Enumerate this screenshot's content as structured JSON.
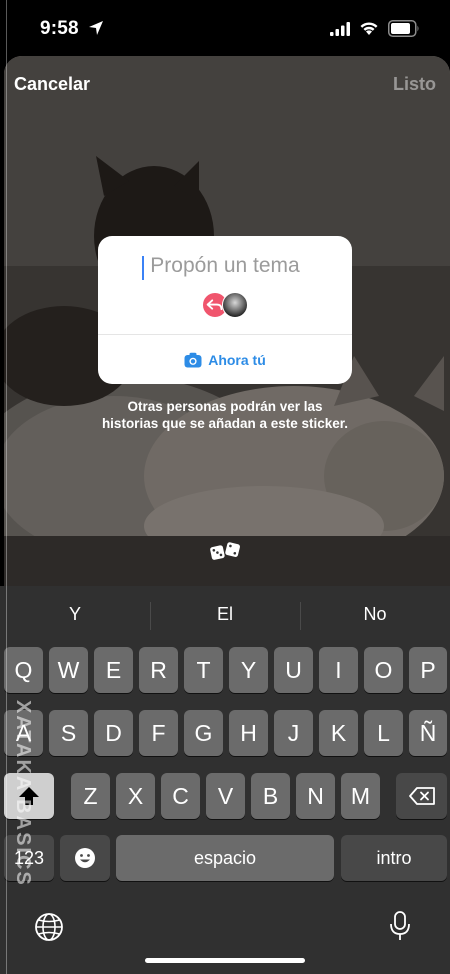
{
  "status_bar": {
    "time": "9:58"
  },
  "header": {
    "cancel_label": "Cancelar",
    "done_label": "Listo"
  },
  "sticker": {
    "placeholder": "Propón un tema",
    "cta_label": "Ahora tú"
  },
  "caption": {
    "line1": "Otras personas podrán ver las",
    "line2": "historias que se añadan a este sticker."
  },
  "keyboard": {
    "suggestions": [
      "Y",
      "El",
      "No"
    ],
    "row1": [
      "Q",
      "W",
      "E",
      "R",
      "T",
      "Y",
      "U",
      "I",
      "O",
      "P"
    ],
    "row2": [
      "A",
      "S",
      "D",
      "F",
      "G",
      "H",
      "J",
      "K",
      "L",
      "Ñ"
    ],
    "row3": [
      "Z",
      "X",
      "C",
      "V",
      "B",
      "N",
      "M"
    ],
    "numbers_label": "123",
    "space_label": "espacio",
    "return_label": "intro"
  },
  "watermark": {
    "text": "XATAKA BASICS"
  },
  "icons": [
    "location-arrow-icon",
    "signal-icon",
    "wifi-icon",
    "battery-icon",
    "reply-icon",
    "camera-icon",
    "dice-icon",
    "shift-icon",
    "backspace-icon",
    "emoji-icon",
    "globe-icon",
    "microphone-icon"
  ],
  "colors": {
    "accent_blue": "#2d8ce6",
    "reply_pink": "#f0556d",
    "keyboard_bg": "#303030"
  }
}
